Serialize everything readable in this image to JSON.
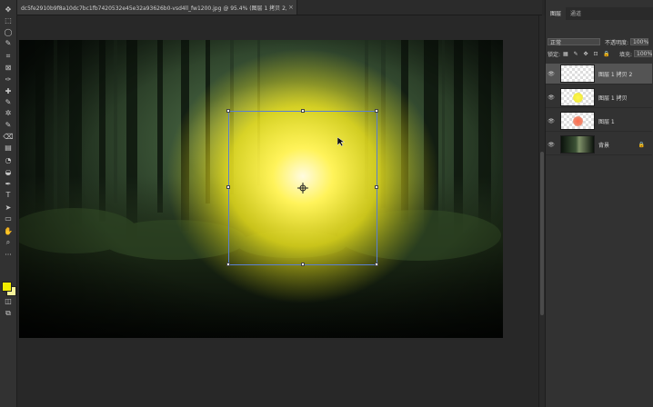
{
  "document_tab": {
    "title": "dc5fe2910b9f8a10dc7bc1fb7420532e45e32a93626b0-vsd4ll_fw1200.jpg @ 95.4% (图层 1 拷贝 2, RGB/8#) *",
    "close": "×"
  },
  "toolbar": {
    "tools": [
      "move-icon",
      "marquee-icon",
      "lasso-icon",
      "quick-select-icon",
      "crop-icon",
      "frame-icon",
      "eyedropper-icon",
      "healing-icon",
      "brush-icon",
      "stamp-icon",
      "history-brush-icon",
      "eraser-icon",
      "gradient-icon",
      "blur-icon",
      "dodge-icon",
      "pen-icon",
      "type-icon",
      "path-select-icon",
      "shape-icon",
      "hand-icon",
      "zoom-icon",
      "more-icon"
    ],
    "tool_glyphs": [
      "✥",
      "⬚",
      "◯",
      "✎",
      "⌗",
      "⊠",
      "✑",
      "✚",
      "✎",
      "✲",
      "✎",
      "⌫",
      "▤",
      "◔",
      "◒",
      "✒",
      "T",
      "➤",
      "▭",
      "✋",
      "⌕",
      "···"
    ],
    "foreground_color": "#f0ec00",
    "background_color": "#f7f39a",
    "mode_glyphs": [
      "◫",
      "⧉"
    ]
  },
  "panel": {
    "tabs": [
      "图层",
      "通道"
    ],
    "blend_mode": "正常",
    "opacity_label": "不透明度:",
    "opacity_value": "100%",
    "lock_label": "锁定:",
    "fill_label": "填充:",
    "fill_value": "100%",
    "layers": [
      {
        "name": "图层 1 拷贝 2",
        "visible_glyph": "👁",
        "thumb": "checker",
        "active": true
      },
      {
        "name": "图层 1 拷贝",
        "visible_glyph": "👁",
        "thumb": "checker-yellow",
        "active": false
      },
      {
        "name": "图层 1",
        "visible_glyph": "👁",
        "thumb": "checker-red",
        "active": false
      },
      {
        "name": "背景",
        "visible_glyph": "👁",
        "thumb": "forest",
        "active": false,
        "lock": "🔒"
      }
    ]
  },
  "colors": {
    "selection": "#5a7fd0",
    "glow": "#fff4a0"
  }
}
